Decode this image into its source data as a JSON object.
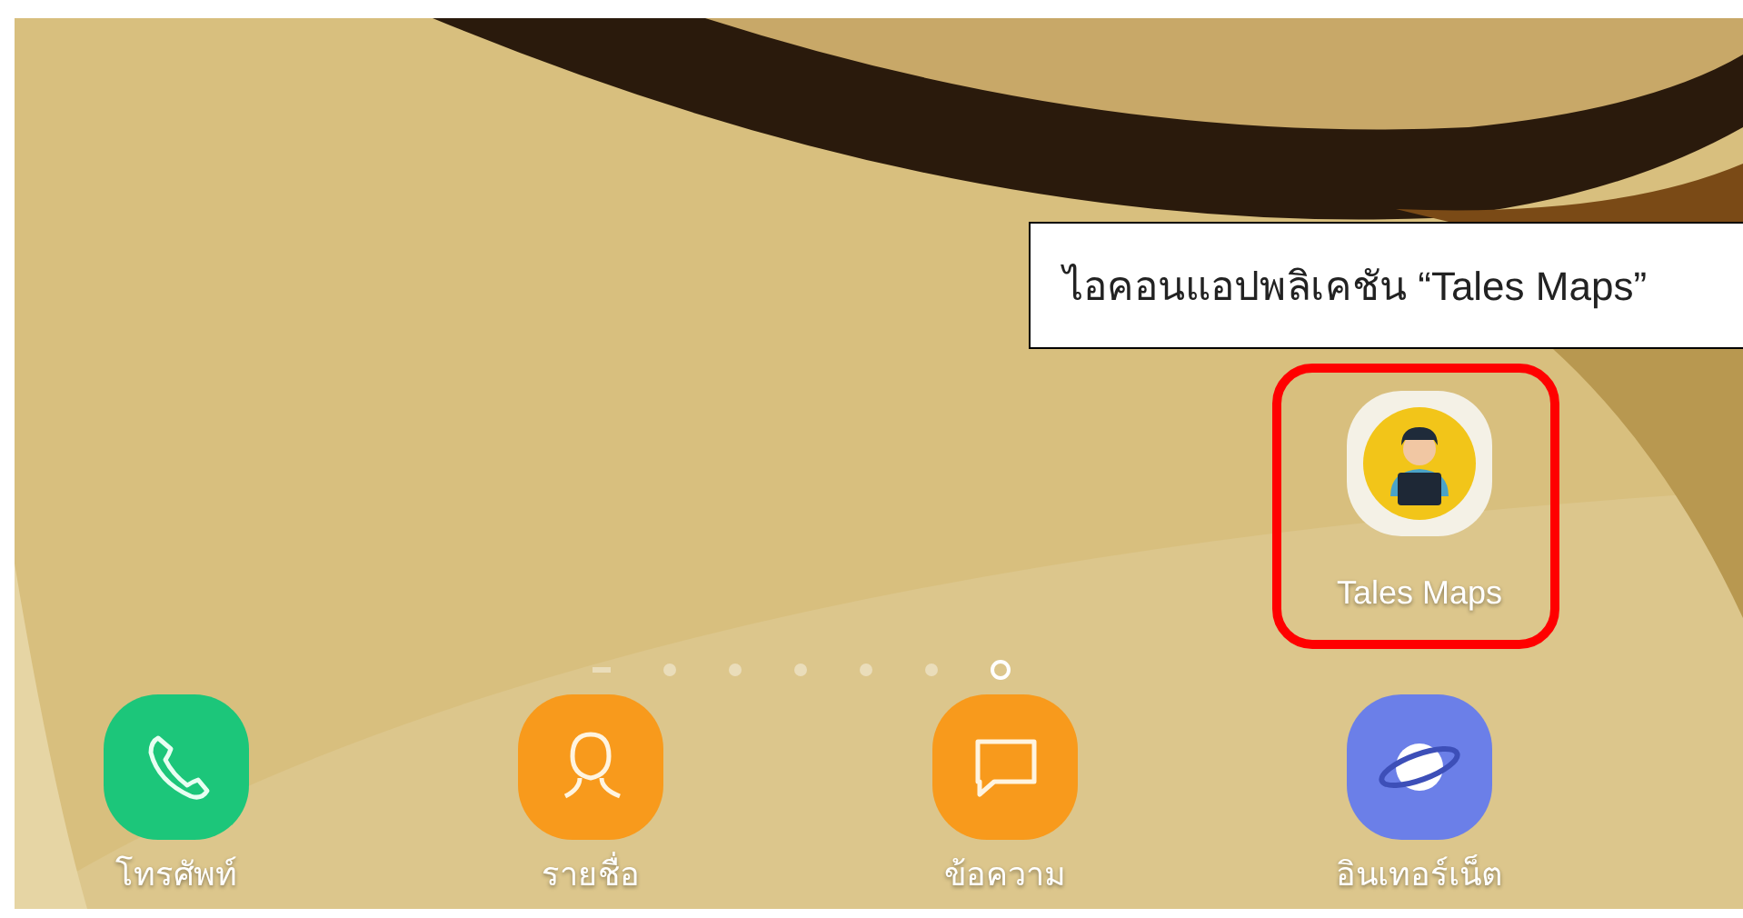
{
  "callout": {
    "text": "ไอคอนแอปพลิเคชัน “Tales Maps”"
  },
  "app": {
    "label": "Tales Maps",
    "highlighted": true
  },
  "page_indicator": [
    {
      "kind": "home",
      "selected": false
    },
    {
      "kind": "dot",
      "selected": false
    },
    {
      "kind": "dot",
      "selected": false
    },
    {
      "kind": "dot",
      "selected": false
    },
    {
      "kind": "dot",
      "selected": false
    },
    {
      "kind": "dot",
      "selected": false
    },
    {
      "kind": "dot",
      "selected": true
    }
  ],
  "dock": [
    {
      "kind": "phone",
      "label": "โทรศัพท์"
    },
    {
      "kind": "contacts",
      "label": "รายชื่อ"
    },
    {
      "kind": "messages",
      "label": "ข้อความ"
    },
    {
      "kind": "internet",
      "label": "อินเทอร์เน็ต"
    }
  ]
}
